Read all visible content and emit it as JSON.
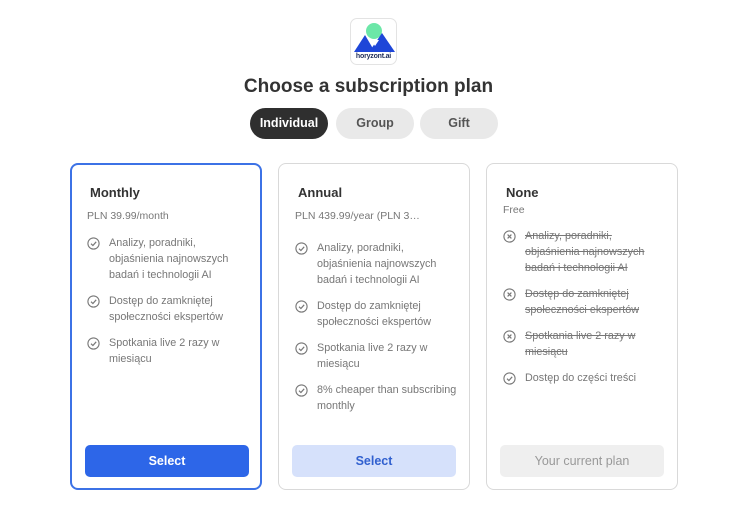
{
  "logo": {
    "text": "horyzont.ai"
  },
  "title": "Choose a subscription plan",
  "tabs": [
    {
      "label": "Individual",
      "active": true
    },
    {
      "label": "Group",
      "active": false
    },
    {
      "label": "Gift",
      "active": false
    }
  ],
  "plans": [
    {
      "name": "Monthly",
      "price": "PLN 39.99/month",
      "selected": true,
      "features": [
        {
          "text": "Analizy, poradniki, objaśnienia najnowszych badań i technologii AI",
          "included": true
        },
        {
          "text": "Dostęp do zamkniętej społeczności ekspertów",
          "included": true
        },
        {
          "text": "Spotkania live 2 razy w miesiącu",
          "included": true
        }
      ],
      "button": "Select"
    },
    {
      "name": "Annual",
      "price": "PLN 439.99/year (PLN 3…",
      "selected": false,
      "features": [
        {
          "text": "Analizy, poradniki, objaśnienia najnowszych badań i technologii AI",
          "included": true
        },
        {
          "text": "Dostęp do zamkniętej społeczności ekspertów",
          "included": true
        },
        {
          "text": "Spotkania live 2 razy w miesiącu",
          "included": true
        },
        {
          "text": "8% cheaper than subscribing monthly",
          "included": true
        }
      ],
      "button": "Select"
    },
    {
      "name": "None",
      "price": "Free",
      "selected": false,
      "features": [
        {
          "text": "Analizy, poradniki, objaśnienia najnowszych badań i technologii AI",
          "included": false
        },
        {
          "text": "Dostęp do zamkniętej społeczności ekspertów",
          "included": false
        },
        {
          "text": "Spotkania live 2 razy w miesiącu",
          "included": false
        },
        {
          "text": "Dostęp do części treści",
          "included": true
        }
      ],
      "button": "Your current plan"
    }
  ],
  "colors": {
    "accent": "#2d66e8",
    "dark_tab": "#2f2f2f"
  },
  "icons": {
    "included": "check-circle-icon",
    "excluded": "x-circle-icon"
  }
}
